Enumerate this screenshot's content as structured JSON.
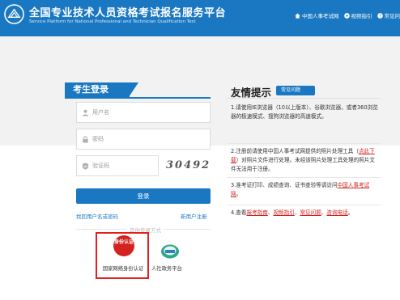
{
  "header": {
    "title_cn": "全国专业技术人员资格考试报名服务平台",
    "title_en": "Service Platform for National Professional and Technician Qualification Test",
    "links": [
      {
        "icon": "home-icon",
        "label": "中国人事考试网"
      },
      {
        "icon": "play-icon",
        "label": "视频指引"
      },
      {
        "icon": "question-icon",
        "label": "常见问"
      }
    ]
  },
  "login": {
    "title": "考生登录",
    "username_placeholder": "用户名",
    "password_placeholder": "密码",
    "captcha_placeholder": "验证码",
    "captcha_text": "30492",
    "button_label": "登录",
    "forgot_label": "找回用户名或密码",
    "register_label": "新用户注册",
    "other_methods_label": "其他登录方式",
    "id_auth_badge": "身份认证",
    "id_auth_label": "国家网络身份认证",
    "gov_label": "人社政务平台"
  },
  "tips": {
    "title": "友情提示",
    "tag": "常见问题",
    "items": [
      {
        "text": "1.请使用IE浏览器（10以上版本）、谷歌浏览器，或者360浏览器的极速模式、搜狗浏览器的高速模式。"
      },
      {
        "pre": "2.注册前请使用中国人事考试网提供的照片处理工具（",
        "link": "点此下载",
        "post": "）对照片文件进行处理。未经该照片处理工具处理的照片文件无法用于注册。"
      },
      {
        "pre": "3.准考证打印、成绩查询、证书查验等请访问",
        "link": "中国人事考试网",
        "post": "。"
      },
      {
        "pre": "4.查看",
        "links": [
          "报考指南",
          "视频指引",
          "常见问题",
          "咨询电话"
        ],
        "sep": "、",
        "post": "。"
      }
    ]
  },
  "colors": {
    "primary": "#1a78c2",
    "accent": "#d4231f",
    "band": "#f2f2f2"
  }
}
